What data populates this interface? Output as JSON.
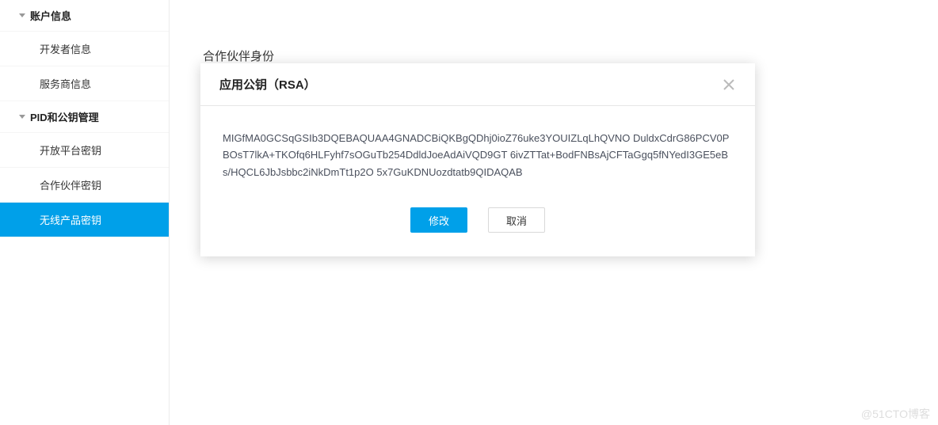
{
  "sidebar": {
    "sections": [
      {
        "title": "账户信息",
        "items": [
          {
            "label": "开发者信息",
            "active": false
          },
          {
            "label": "服务商信息",
            "active": false
          }
        ]
      },
      {
        "title": "PID和公钥管理",
        "items": [
          {
            "label": "开放平台密钥",
            "active": false
          },
          {
            "label": "合作伙伴密钥",
            "active": false
          },
          {
            "label": "无线产品密钥",
            "active": true
          }
        ]
      }
    ]
  },
  "page": {
    "title": "合作伙伴身份"
  },
  "modal": {
    "title": "应用公钥（RSA）",
    "body": "MIGfMA0GCSqGSIb3DQEBAQUAA4GNADCBiQKBgQDhj0ioZ76uke3YOUIZLqLhQVNO DuldxCdrG86PCV0PBOsT7lkA+TKOfq6HLFyhf7sOGuTb254DdldJoeAdAiVQD9GT 6ivZTTat+BodFNBsAjCFTaGgq5fNYedI3GE5eBs/HQCL6JbJsbbc2iNkDmTt1p2O 5x7GuKDNUozdtatb9QIDAQAB",
    "buttons": {
      "primary": "修改",
      "cancel": "取消"
    }
  },
  "watermark": "@51CTO博客"
}
